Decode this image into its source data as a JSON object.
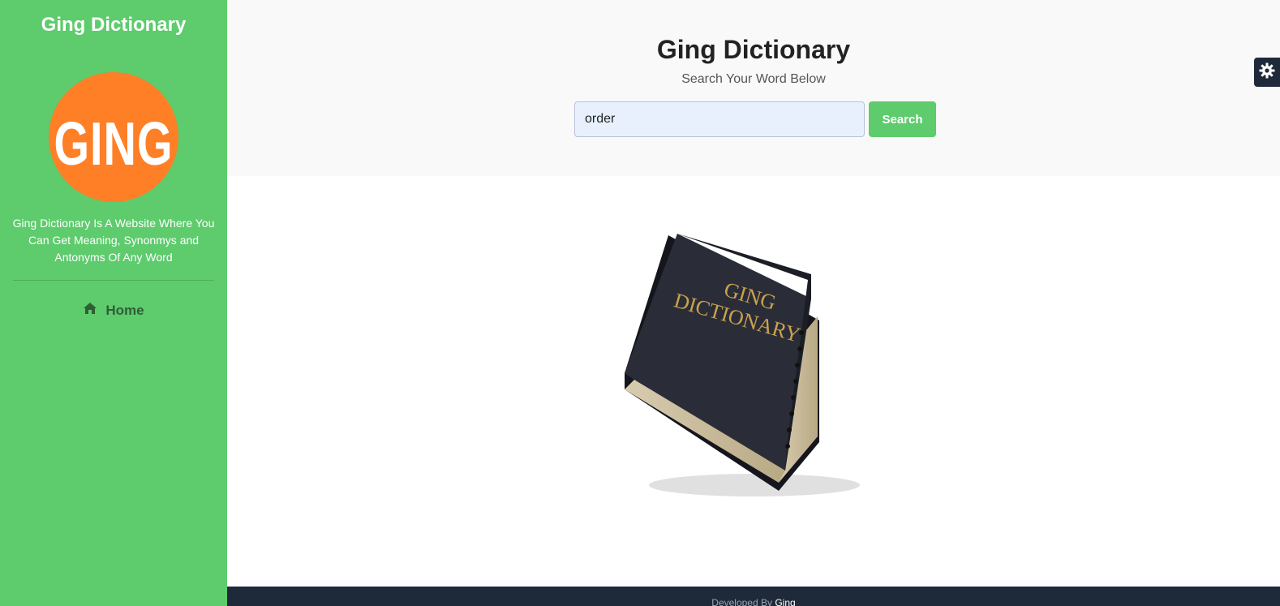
{
  "sidebar": {
    "title": "Ging Dictionary",
    "logo_text": "GING",
    "tagline": "Ging Dictionary Is A Website Where You Can Get Meaning, Synonmys and Antonyms Of Any Word",
    "nav": [
      {
        "label": "Home",
        "icon": "home-icon"
      }
    ]
  },
  "header": {
    "title": "Ging Dictionary",
    "subtitle": "Search Your Word Below"
  },
  "search": {
    "value": "order",
    "button_label": "Search"
  },
  "book": {
    "title_line1": "GING",
    "title_line2": "DICTIONARY"
  },
  "footer": {
    "prefix": "Developed By",
    "link": "Ging"
  },
  "settings": {
    "icon": "gear-icon"
  },
  "colors": {
    "sidebar_bg": "#5ecb6d",
    "logo_bg": "#ff7f27",
    "footer_bg": "#1e2a3a",
    "accent_button": "#5ecb6d"
  }
}
